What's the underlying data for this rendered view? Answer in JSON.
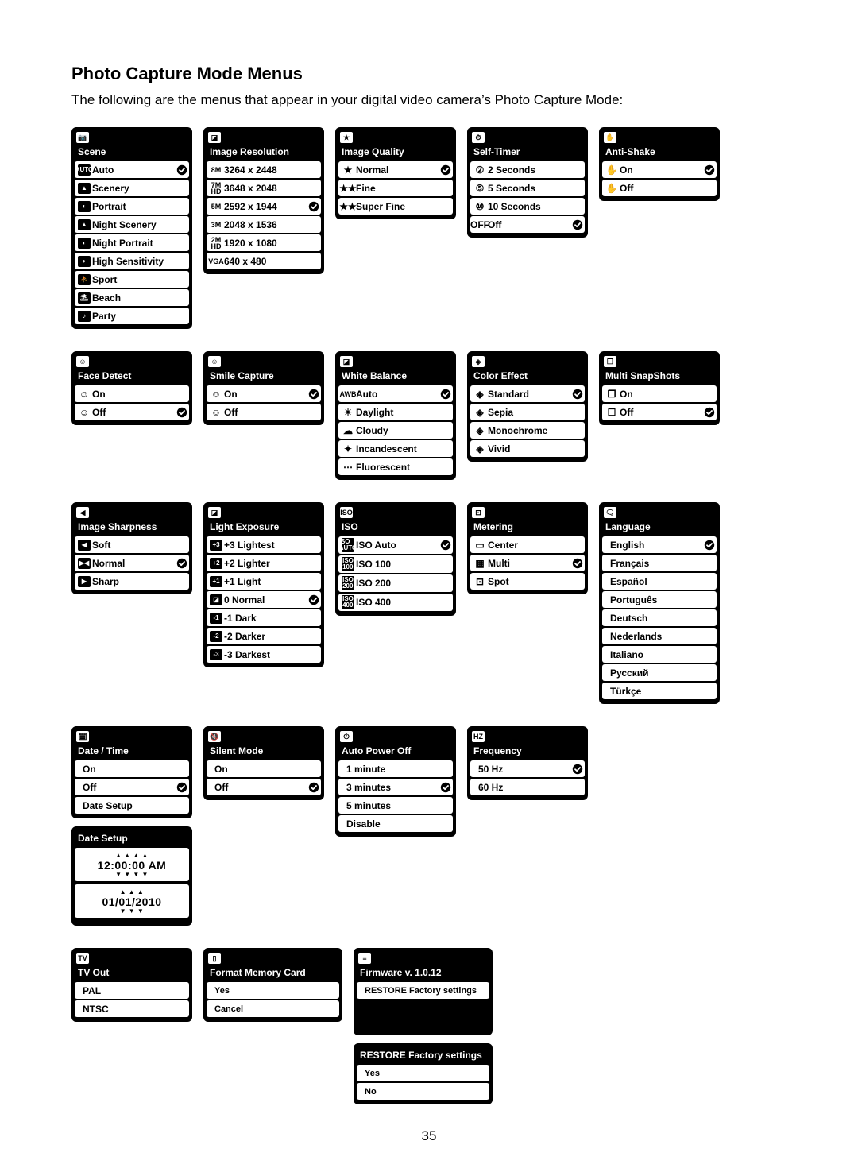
{
  "heading": "Photo Capture Mode Menus",
  "intro": "The following are the menus that appear in your digital video camera’s Photo Capture Mode:",
  "page_number": "35",
  "row1": {
    "scene": {
      "title": "Scene",
      "items": [
        {
          "icon_style": "box",
          "icon": "AUTO",
          "label": "Auto",
          "checked": true
        },
        {
          "icon_style": "box",
          "icon": "▲",
          "label": "Scenery"
        },
        {
          "icon_style": "box",
          "icon": "◐",
          "label": "Portrait"
        },
        {
          "icon_style": "box",
          "icon": "▲",
          "label": "Night Scenery"
        },
        {
          "icon_style": "box",
          "icon": "◐",
          "label": "Night Portrait"
        },
        {
          "icon_style": "box",
          "icon": "◗",
          "label": "High Sensitivity"
        },
        {
          "icon_style": "box",
          "icon": "⛹",
          "label": "Sport"
        },
        {
          "icon_style": "box",
          "icon": "⛱",
          "label": "Beach"
        },
        {
          "icon_style": "box",
          "icon": "♪",
          "label": "Party"
        }
      ]
    },
    "image_resolution": {
      "title": "Image Resolution",
      "items": [
        {
          "icon_style": "plain",
          "icon": "8M",
          "label": "3264 x 2448"
        },
        {
          "icon_style": "plain",
          "icon": "7M\nHD",
          "label": "3648 x 2048"
        },
        {
          "icon_style": "plain",
          "icon": "5M",
          "label": "2592 x 1944",
          "checked": true
        },
        {
          "icon_style": "plain",
          "icon": "3M",
          "label": "2048 x 1536"
        },
        {
          "icon_style": "plain",
          "icon": "2M\nHD",
          "label": "1920 x 1080"
        },
        {
          "icon_style": "plain",
          "icon": "VGA",
          "label": "640 x 480"
        }
      ]
    },
    "image_quality": {
      "title": "Image Quality",
      "items": [
        {
          "icon_style": "sym",
          "icon": "★",
          "label": "Normal",
          "checked": true
        },
        {
          "icon_style": "sym",
          "icon": "★★",
          "label": "Fine"
        },
        {
          "icon_style": "sym",
          "icon": "★★",
          "label": "Super Fine"
        }
      ]
    },
    "self_timer": {
      "title": "Self-Timer",
      "items": [
        {
          "icon_style": "sym",
          "icon": "②",
          "label": "2 Seconds"
        },
        {
          "icon_style": "sym",
          "icon": "⑤",
          "label": "5 Seconds"
        },
        {
          "icon_style": "sym",
          "icon": "⑩",
          "label": "10 Seconds"
        },
        {
          "icon_style": "sym",
          "icon": "OFF",
          "label": "Off",
          "checked": true
        }
      ]
    },
    "anti_shake": {
      "title": "Anti-Shake",
      "items": [
        {
          "icon_style": "sym",
          "icon": "✋",
          "label": "On",
          "checked": true
        },
        {
          "icon_style": "sym",
          "icon": "✋",
          "label": "Off"
        }
      ]
    }
  },
  "row2": {
    "face_detect": {
      "title": "Face Detect",
      "items": [
        {
          "icon_style": "sym",
          "icon": "☺",
          "label": "On"
        },
        {
          "icon_style": "sym",
          "icon": "☺",
          "label": "Off",
          "checked": true
        }
      ]
    },
    "smile_capture": {
      "title": "Smile Capture",
      "items": [
        {
          "icon_style": "sym",
          "icon": "☺",
          "label": "On",
          "checked": true
        },
        {
          "icon_style": "sym",
          "icon": "☺",
          "label": "Off"
        }
      ]
    },
    "white_balance": {
      "title": "White Balance",
      "items": [
        {
          "icon_style": "plain",
          "icon": "AWB",
          "label": "Auto",
          "checked": true
        },
        {
          "icon_style": "sym",
          "icon": "☀",
          "label": "Daylight"
        },
        {
          "icon_style": "sym",
          "icon": "☁",
          "label": "Cloudy"
        },
        {
          "icon_style": "sym",
          "icon": "✦",
          "label": "Incandescent"
        },
        {
          "icon_style": "sym",
          "icon": "⋯",
          "label": "Fluorescent"
        }
      ]
    },
    "color_effect": {
      "title": "Color Effect",
      "items": [
        {
          "icon_style": "sym",
          "icon": "◈",
          "label": "Standard",
          "checked": true
        },
        {
          "icon_style": "sym",
          "icon": "◈",
          "label": "Sepia"
        },
        {
          "icon_style": "sym",
          "icon": "◈",
          "label": "Monochrome"
        },
        {
          "icon_style": "sym",
          "icon": "◈",
          "label": "Vivid"
        }
      ]
    },
    "multi_snapshots": {
      "title": "Multi SnapShots",
      "items": [
        {
          "icon_style": "sym",
          "icon": "❐",
          "label": "On"
        },
        {
          "icon_style": "sym",
          "icon": "☐",
          "label": "Off",
          "checked": true
        }
      ]
    }
  },
  "row3": {
    "image_sharpness": {
      "title": "Image Sharpness",
      "items": [
        {
          "icon_style": "box",
          "icon": "◀",
          "label": "Soft"
        },
        {
          "icon_style": "box",
          "icon": "▶◀",
          "label": "Normal",
          "checked": true
        },
        {
          "icon_style": "box",
          "icon": "▶",
          "label": "Sharp"
        }
      ]
    },
    "light_exposure": {
      "title": "Light Exposure",
      "items": [
        {
          "icon_style": "box",
          "icon": "+3",
          "label": "+3 Lightest"
        },
        {
          "icon_style": "box",
          "icon": "+2",
          "label": "+2 Lighter"
        },
        {
          "icon_style": "box",
          "icon": "+1",
          "label": "+1 Light"
        },
        {
          "icon_style": "box",
          "icon": "◪",
          "label": "0 Normal",
          "checked": true
        },
        {
          "icon_style": "box",
          "icon": "-1",
          "label": "-1 Dark"
        },
        {
          "icon_style": "box",
          "icon": "-2",
          "label": "-2 Darker"
        },
        {
          "icon_style": "box",
          "icon": "-3",
          "label": "-3 Darkest"
        }
      ]
    },
    "iso": {
      "title": "ISO",
      "items": [
        {
          "icon_style": "box",
          "icon": "ISO\nAUTO",
          "label": "ISO Auto",
          "checked": true
        },
        {
          "icon_style": "box",
          "icon": "ISO\n100",
          "label": "ISO 100"
        },
        {
          "icon_style": "box",
          "icon": "ISO\n200",
          "label": "ISO 200"
        },
        {
          "icon_style": "box",
          "icon": "ISO\n400",
          "label": "ISO 400"
        }
      ]
    },
    "metering": {
      "title": "Metering",
      "items": [
        {
          "icon_style": "sym",
          "icon": "▭",
          "label": "Center"
        },
        {
          "icon_style": "sym",
          "icon": "▦",
          "label": "Multi",
          "checked": true
        },
        {
          "icon_style": "sym",
          "icon": "⊡",
          "label": "Spot"
        }
      ]
    },
    "language": {
      "title": "Language",
      "items": [
        {
          "icon_style": "none",
          "label": "English",
          "checked": true
        },
        {
          "icon_style": "none",
          "label": "Français"
        },
        {
          "icon_style": "none",
          "label": "Español"
        },
        {
          "icon_style": "none",
          "label": "Português"
        },
        {
          "icon_style": "none",
          "label": "Deutsch"
        },
        {
          "icon_style": "none",
          "label": "Nederlands"
        },
        {
          "icon_style": "none",
          "label": "Italiano"
        },
        {
          "icon_style": "none",
          "label": "Русский"
        },
        {
          "icon_style": "none",
          "label": "Türkçe"
        }
      ]
    }
  },
  "row4": {
    "date_time": {
      "title": "Date / Time",
      "items": [
        {
          "icon_style": "none",
          "label": "On"
        },
        {
          "icon_style": "none",
          "label": "Off",
          "checked": true
        },
        {
          "icon_style": "none",
          "label": "Date Setup"
        }
      ]
    },
    "date_setup": {
      "title": "Date Setup",
      "time": "12:00:00 AM",
      "date": "01/01/2010"
    },
    "silent_mode": {
      "title": "Silent Mode",
      "items": [
        {
          "icon_style": "none",
          "label": "On"
        },
        {
          "icon_style": "none",
          "label": "Off",
          "checked": true
        }
      ]
    },
    "auto_power_off": {
      "title": "Auto Power Off",
      "items": [
        {
          "icon_style": "none",
          "label": "1 minute"
        },
        {
          "icon_style": "none",
          "label": "3 minutes",
          "checked": true
        },
        {
          "icon_style": "none",
          "label": "5 minutes"
        },
        {
          "icon_style": "none",
          "label": "Disable"
        }
      ]
    },
    "frequency": {
      "title": "Frequency",
      "items": [
        {
          "icon_style": "none",
          "label": "50 Hz",
          "checked": true
        },
        {
          "icon_style": "none",
          "label": "60 Hz"
        }
      ]
    }
  },
  "row5": {
    "tv_out": {
      "title": "TV Out",
      "items": [
        {
          "icon_style": "none",
          "label": "PAL"
        },
        {
          "icon_style": "none",
          "label": "NTSC"
        }
      ]
    },
    "format_card": {
      "title": "Format Memory Card",
      "items": [
        {
          "icon_style": "none",
          "label": "Yes"
        },
        {
          "icon_style": "none",
          "label": "Cancel"
        }
      ]
    },
    "firmware": {
      "title": "Firmware v. 1.0.12",
      "items": [
        {
          "icon_style": "none",
          "label": "RESTORE Factory settings"
        }
      ]
    },
    "restore": {
      "title": "RESTORE Factory settings",
      "items": [
        {
          "icon_style": "none",
          "label": "Yes"
        },
        {
          "icon_style": "none",
          "label": "No"
        }
      ]
    }
  }
}
